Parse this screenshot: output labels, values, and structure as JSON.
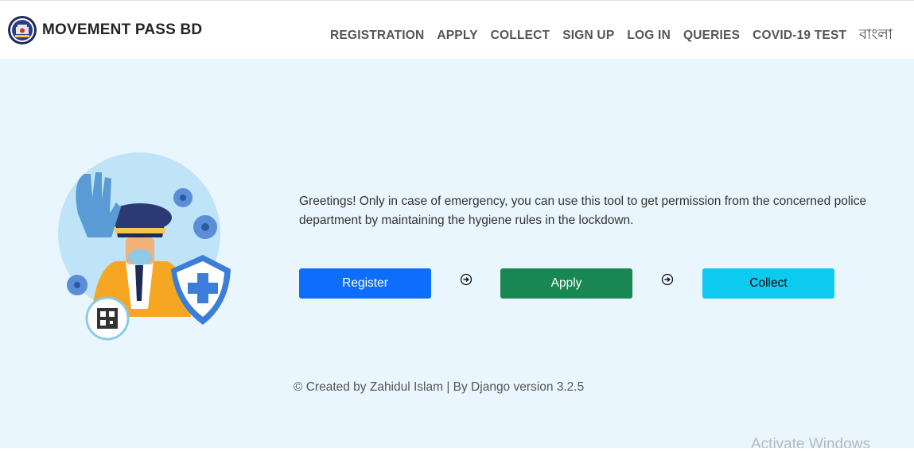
{
  "brand": {
    "name": "MOVEMENT PASS BD",
    "logo_icon": "police-emblem-icon"
  },
  "nav": {
    "items": [
      {
        "label": "REGISTRATION"
      },
      {
        "label": "APPLY"
      },
      {
        "label": "COLLECT"
      },
      {
        "label": "SIGN UP"
      },
      {
        "label": "LOG IN"
      },
      {
        "label": "QUERIES"
      },
      {
        "label": "COVID-19 TEST"
      },
      {
        "label": "বাংলা"
      }
    ]
  },
  "hero": {
    "greeting": "Greetings! Only in case of emergency, you can use this tool to get permission from the concerned police department by maintaining the hygiene rules in the lockdown.",
    "illustration_icon": "police-officer-stop-illustration",
    "buttons": {
      "register": "Register",
      "apply": "Apply",
      "collect": "Collect"
    },
    "step_arrow_icon": "circle-arrow-right-icon",
    "credit": "© Created by Zahidul Islam | By Django version 3.2.5"
  },
  "system": {
    "watermark": "Activate Windows"
  },
  "colors": {
    "hero_background": "#eaf6fd",
    "register": "#0d6efd",
    "apply": "#198754",
    "collect": "#0dcaf0"
  }
}
